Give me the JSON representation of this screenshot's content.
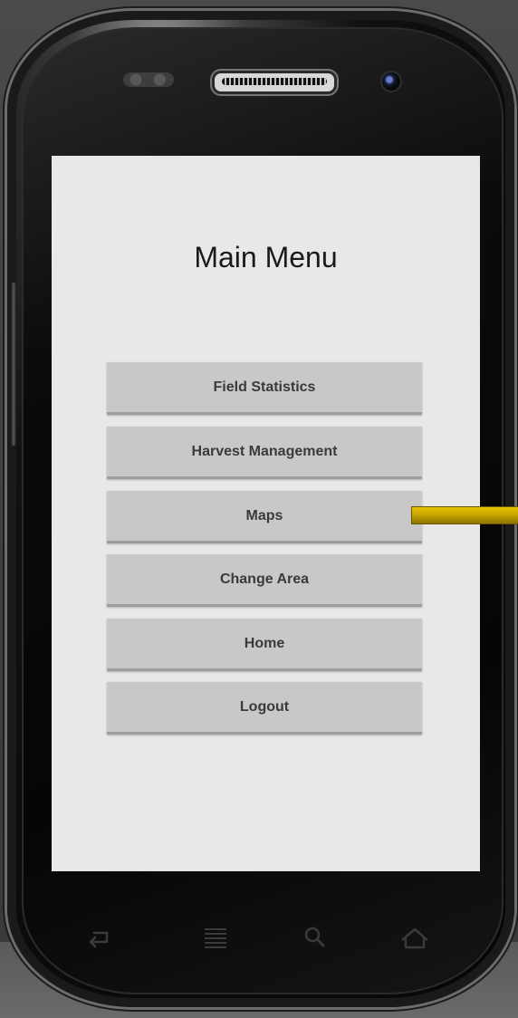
{
  "screen": {
    "title": "Main Menu",
    "background": "#e8e8e8"
  },
  "menu": {
    "items": [
      {
        "label": "Field Statistics"
      },
      {
        "label": "Harvest Management"
      },
      {
        "label": "Maps"
      },
      {
        "label": "Change Area"
      },
      {
        "label": "Home"
      },
      {
        "label": "Logout"
      }
    ],
    "button_color": "#c8c8c8",
    "text_color": "#3a3a3a"
  },
  "navbar": {
    "icons": [
      "back-icon",
      "menu-icon",
      "search-icon",
      "home-icon"
    ]
  },
  "annotation": {
    "arrow_color": "#c9a600",
    "points_to": "Maps"
  }
}
